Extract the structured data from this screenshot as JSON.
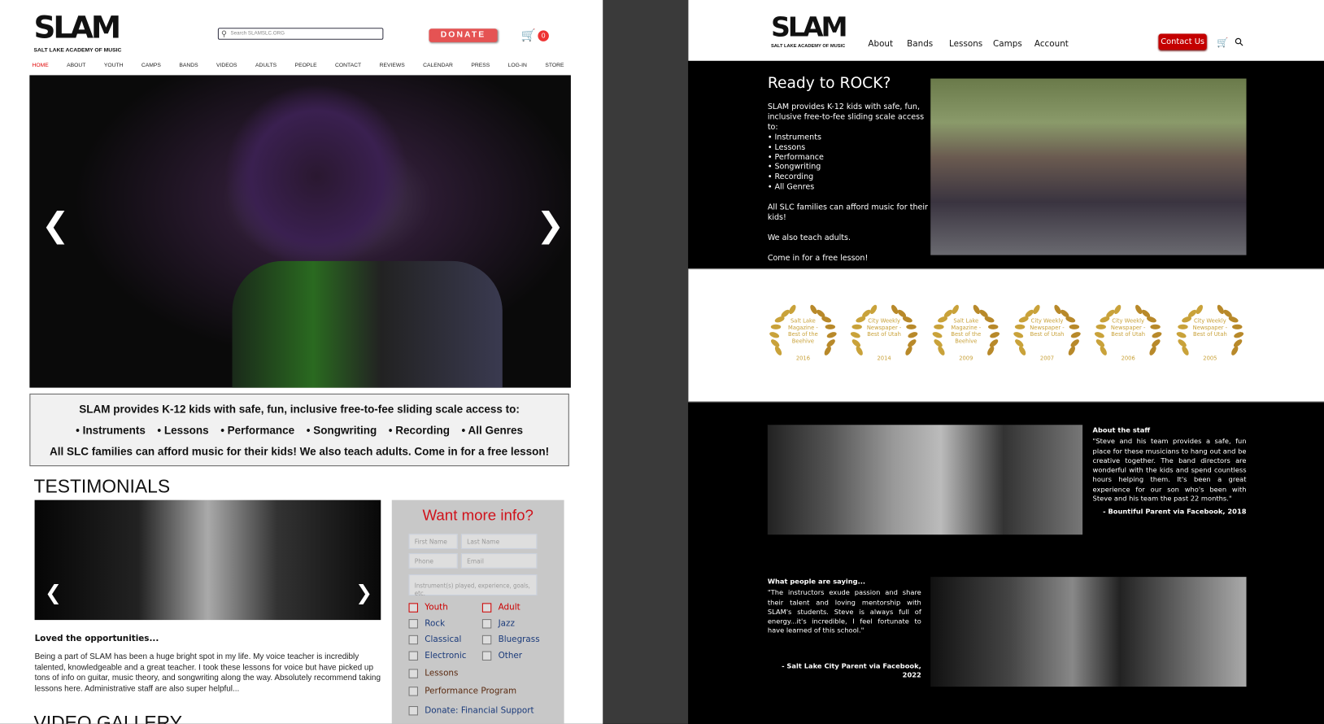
{
  "left": {
    "logo": {
      "text": "SLAM",
      "subtitle": "SALT LAKE ACADEMY OF MUSIC"
    },
    "search": {
      "placeholder": "Search SLAMSLC.ORG"
    },
    "donate_label": "DONATE",
    "cart_count": "0",
    "nav": [
      "HOME",
      "ABOUT",
      "YOUTH",
      "CAMPS",
      "BANDS",
      "VIDEOS",
      "ADULTS",
      "PEOPLE",
      "CONTACT",
      "REVIEWS",
      "CALENDAR",
      "PRESS",
      "LOG-IN",
      "STORE"
    ],
    "active_nav": "HOME",
    "info": {
      "line1": "SLAM provides K-12 kids with safe, fun, inclusive free-to-fee sliding scale access to:",
      "items": [
        "• Instruments",
        "• Lessons",
        "• Performance",
        "• Songwriting",
        "• Recording",
        "• All Genres"
      ],
      "line3": "All SLC families can afford music for their kids!  We also teach adults.  Come in for a free lesson!"
    },
    "testimonials": {
      "title": "TESTIMONIALS",
      "heading": "Loved the opportunities...",
      "body": "Being a part of SLAM has been a huge bright spot in my life. My voice teacher is incredibly talented, knowledgeable and a great teacher. I took these lessons for voice but have picked up tons of info on guitar, music theory, and songwriting along the way. Absolutely recommend taking lessons here. Administrative staff are also super helpful..."
    },
    "video_gallery_title": "VIDEO GALLERY",
    "form": {
      "title": "Want more info?",
      "first_name": "First Name",
      "last_name": "Last Name",
      "phone": "Phone",
      "email": "Email",
      "message": "Instrument(s) played, experience, goals, etc.",
      "checkboxes": [
        {
          "label": "Youth",
          "color": "#cc0000"
        },
        {
          "label": "Adult",
          "color": "#cc0000"
        },
        {
          "label": "Rock",
          "color": "#1a3a7a"
        },
        {
          "label": "Jazz",
          "color": "#1a3a7a"
        },
        {
          "label": "Classical",
          "color": "#1a3a7a"
        },
        {
          "label": "Bluegrass",
          "color": "#1a3a7a"
        },
        {
          "label": "Electronic",
          "color": "#1a3a7a"
        },
        {
          "label": "Other",
          "color": "#1a3a7a"
        },
        {
          "label": "Lessons",
          "color": "#5a2a10"
        },
        {
          "label": "Performance Program",
          "color": "#5a2a10"
        },
        {
          "label": "Donate: Financial Support",
          "color": "#1a3a7a"
        }
      ]
    }
  },
  "right": {
    "logo": {
      "text": "SLAM",
      "subtitle": "SALT LAKE ACADEMY OF MUSIC"
    },
    "nav": [
      "About",
      "Bands",
      "Lessons",
      "Camps",
      "Account"
    ],
    "contact_label": "Contact Us",
    "hero": {
      "title": "Ready to ROCK?",
      "intro": "SLAM provides K-12 kids with safe, fun, inclusive free-to-fee sliding scale access to:",
      "items": [
        "• Instruments",
        "• Lessons",
        "• Performance",
        "• Songwriting",
        "• Recording",
        "• All Genres"
      ],
      "p1": "All SLC families can afford music for their kids!",
      "p2": "We also teach adults.",
      "p3": "Come in for a free lesson!"
    },
    "awards": [
      {
        "text": "Salt Lake Magazine - Best of the Beehive",
        "year": "2016"
      },
      {
        "text": "City Weekly Newspaper - Best of Utah",
        "year": "2014"
      },
      {
        "text": "Salt Lake Magazine - Best of the Beehive",
        "year": "2009"
      },
      {
        "text": "City Weekly Newspaper - Best of Utah",
        "year": "2007"
      },
      {
        "text": "City Weekly Newspaper - Best of Utah",
        "year": "2006"
      },
      {
        "text": "City Weekly Newspaper - Best of Utah",
        "year": "2005"
      }
    ],
    "staff": {
      "title": "About the staff",
      "quote": "\"Steve and his team provides a safe, fun place for these musicians to hang out and be creative together. The band directors are wonderful with the kids and spend countless hours helping them. It's been a great experience for our son who's been with Steve and his team the past 22 months.\"",
      "attribution": "- Bountiful Parent via Facebook, 2018"
    },
    "people": {
      "title": "What people are saying...",
      "quote": "\"The instructors exude passion and share their talent and loving mentorship with SLAM's students. Steve is always full of energy...it's incredible, I feel fortunate to have learned of this school.\"",
      "attribution": "- Salt Lake City Parent via Facebook, 2022"
    }
  },
  "colors": {
    "donate": "#e55353",
    "contact": "#c40000",
    "award_gold": "#c9a23a",
    "form_title": "#d0121b",
    "active_nav": "#e00000"
  }
}
